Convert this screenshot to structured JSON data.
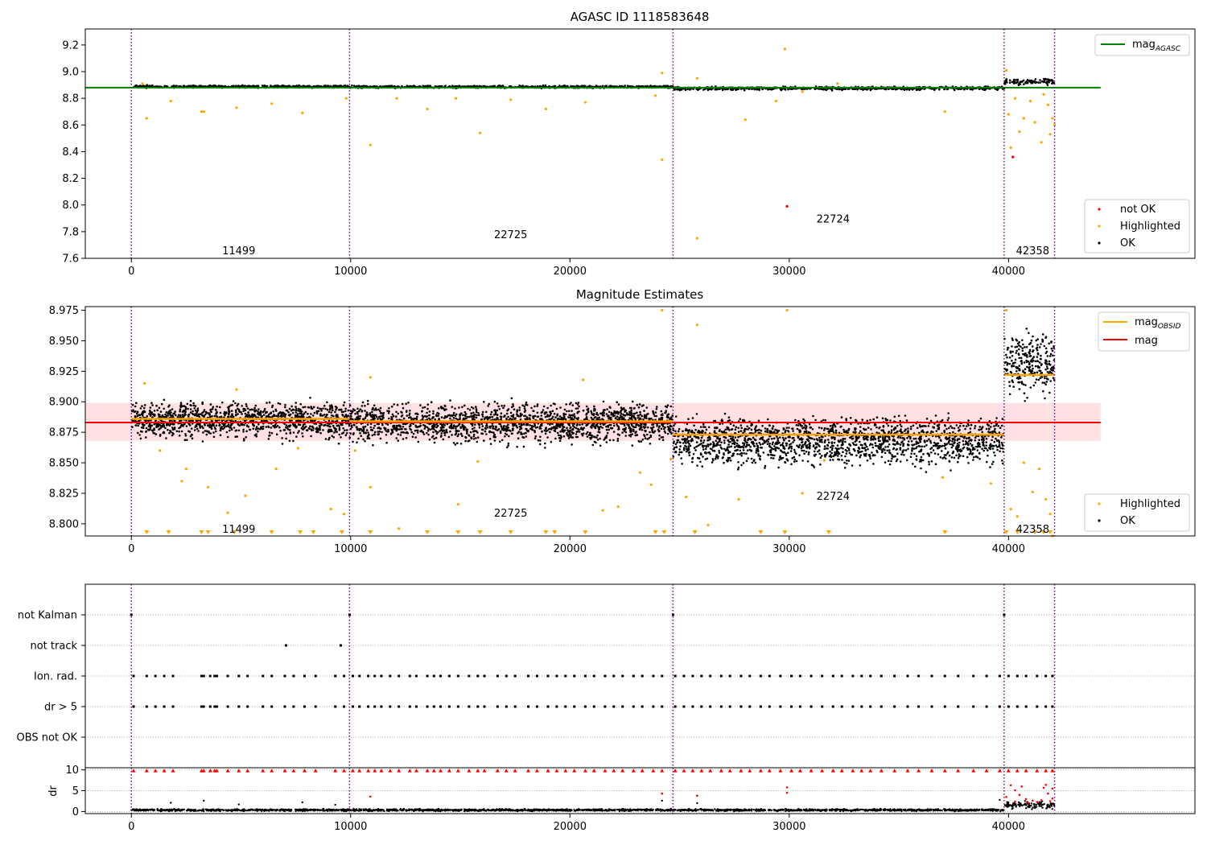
{
  "colors": {
    "ok": "#000000",
    "highlighted": "#ffa500",
    "not_ok": "#ff0000",
    "mag_agasc": "#008000",
    "mag_obsid": "#ffa500",
    "mag": "#ff0000",
    "mag_band": "#ffe0e3",
    "boundary": "#800080",
    "grid": "#b0b0b0"
  },
  "chart_data": [
    {
      "id": "top",
      "type": "scatter",
      "title": "AGASC ID 1118583648",
      "xlim": [
        -2100,
        48500
      ],
      "ylim": [
        7.6,
        9.32
      ],
      "x_ticks": [
        0,
        10000,
        20000,
        30000,
        40000
      ],
      "x_tick_labels": [
        "0",
        "10000",
        "20000",
        "30000",
        "40000"
      ],
      "y_ticks": [
        7.6,
        7.8,
        8.0,
        8.2,
        8.4,
        8.6,
        8.8,
        9.0,
        9.2
      ],
      "y_tick_labels": [
        "7.6",
        "7.8",
        "8.0",
        "8.2",
        "8.4",
        "8.6",
        "8.8",
        "9.0",
        "9.2"
      ],
      "obsid_boundaries": [
        0,
        9950,
        24700,
        39800,
        42100
      ],
      "obsid_labels": [
        {
          "text": "11499",
          "x": 4900,
          "y": 7.66
        },
        {
          "text": "22725",
          "x": 17300,
          "y": 7.78
        },
        {
          "text": "22724",
          "x": 32000,
          "y": 7.9
        },
        {
          "text": "42358",
          "x": 41100,
          "y": 7.66
        }
      ],
      "mag_agasc": {
        "value": 8.88,
        "x_range": [
          -2100,
          44200
        ]
      },
      "ok_bands": [
        {
          "x_range": [
            0,
            9950
          ],
          "center": 8.888,
          "width": 0.012
        },
        {
          "x_range": [
            9950,
            24700
          ],
          "center": 8.886,
          "width": 0.012
        },
        {
          "x_range": [
            24700,
            39800
          ],
          "center": 8.875,
          "width": 0.018
        },
        {
          "x_range": [
            39800,
            42100
          ],
          "center": 8.925,
          "width": 0.03
        }
      ],
      "highlighted_points": [
        [
          500,
          8.91
        ],
        [
          700,
          8.65
        ],
        [
          1800,
          8.78
        ],
        [
          3200,
          8.7
        ],
        [
          3300,
          8.7
        ],
        [
          4800,
          8.73
        ],
        [
          6400,
          8.76
        ],
        [
          7800,
          8.69
        ],
        [
          9800,
          8.8
        ],
        [
          10900,
          8.45
        ],
        [
          12100,
          8.8
        ],
        [
          13500,
          8.72
        ],
        [
          14800,
          8.8
        ],
        [
          15900,
          8.54
        ],
        [
          17300,
          8.79
        ],
        [
          18900,
          8.72
        ],
        [
          20700,
          8.77
        ],
        [
          23900,
          8.82
        ],
        [
          24200,
          8.99
        ],
        [
          24200,
          8.34
        ],
        [
          25800,
          8.95
        ],
        [
          25800,
          7.75
        ],
        [
          28000,
          8.64
        ],
        [
          29400,
          8.78
        ],
        [
          29800,
          9.17
        ],
        [
          30600,
          8.85
        ],
        [
          32200,
          8.91
        ],
        [
          37100,
          8.7
        ],
        [
          40000,
          8.68
        ],
        [
          40100,
          8.43
        ],
        [
          40300,
          8.8
        ],
        [
          40500,
          8.55
        ],
        [
          40700,
          8.65
        ],
        [
          41000,
          8.78
        ],
        [
          41200,
          8.62
        ],
        [
          41500,
          8.47
        ],
        [
          41600,
          8.83
        ],
        [
          41800,
          8.75
        ],
        [
          41900,
          8.53
        ],
        [
          42000,
          8.65
        ],
        [
          42100,
          8.6
        ],
        [
          39900,
          9.01
        ]
      ],
      "not_ok_points": [
        [
          29900,
          7.99
        ],
        [
          40200,
          8.36
        ]
      ],
      "legends": [
        {
          "position": "top-right",
          "entries": [
            {
              "label": "mag",
              "sub": "AGASC",
              "kind": "line",
              "color_key": "mag_agasc"
            }
          ]
        },
        {
          "position": "lower-right",
          "entries": [
            {
              "label": "not OK",
              "kind": "marker",
              "color_key": "not_ok"
            },
            {
              "label": "Highlighted",
              "kind": "marker",
              "color_key": "highlighted"
            },
            {
              "label": "OK",
              "kind": "marker",
              "color_key": "ok"
            }
          ]
        }
      ]
    },
    {
      "id": "mid",
      "type": "scatter",
      "title": "Magnitude Estimates",
      "xlim": [
        -2100,
        48500
      ],
      "ylim": [
        8.79,
        8.978
      ],
      "x_ticks": [
        0,
        10000,
        20000,
        30000,
        40000
      ],
      "x_tick_labels": [
        "0",
        "10000",
        "20000",
        "30000",
        "40000"
      ],
      "y_ticks": [
        8.8,
        8.825,
        8.85,
        8.875,
        8.9,
        8.925,
        8.95,
        8.975
      ],
      "y_tick_labels": [
        "8.800",
        "8.825",
        "8.850",
        "8.875",
        "8.900",
        "8.925",
        "8.950",
        "8.975"
      ],
      "obsid_boundaries": [
        0,
        9950,
        24700,
        39800,
        42100
      ],
      "obsid_labels": [
        {
          "text": "11499",
          "x": 4900,
          "y": 8.796
        },
        {
          "text": "22725",
          "x": 17300,
          "y": 8.809
        },
        {
          "text": "22724",
          "x": 32000,
          "y": 8.823
        },
        {
          "text": "42358",
          "x": 41100,
          "y": 8.796
        }
      ],
      "mag": {
        "value": 8.883,
        "x_range": [
          -2100,
          44200
        ],
        "band": [
          8.868,
          8.899
        ]
      },
      "mag_obsid": [
        {
          "x_range": [
            0,
            9950
          ],
          "value": 8.886
        },
        {
          "x_range": [
            9950,
            24700
          ],
          "value": 8.884
        },
        {
          "x_range": [
            24700,
            39800
          ],
          "value": 8.873
        },
        {
          "x_range": [
            39800,
            42100
          ],
          "value": 8.922
        }
      ],
      "ok_bands": [
        {
          "x_range": [
            0,
            9950
          ],
          "center": 8.885,
          "width": 0.02
        },
        {
          "x_range": [
            9950,
            24700
          ],
          "center": 8.883,
          "width": 0.022
        },
        {
          "x_range": [
            24700,
            39800
          ],
          "center": 8.868,
          "width": 0.026
        },
        {
          "x_range": [
            39800,
            42100
          ],
          "center": 8.93,
          "width": 0.035
        }
      ],
      "highlighted_points": [
        [
          600,
          8.915
        ],
        [
          1300,
          8.86
        ],
        [
          2300,
          8.835
        ],
        [
          2500,
          8.845
        ],
        [
          3500,
          8.83
        ],
        [
          4400,
          8.809
        ],
        [
          4800,
          8.91
        ],
        [
          5200,
          8.823
        ],
        [
          6600,
          8.845
        ],
        [
          7600,
          8.862
        ],
        [
          9100,
          8.812
        ],
        [
          9700,
          8.808
        ],
        [
          10200,
          8.86
        ],
        [
          10900,
          8.83
        ],
        [
          10900,
          8.92
        ],
        [
          12200,
          8.796
        ],
        [
          14900,
          8.816
        ],
        [
          15800,
          8.851
        ],
        [
          20600,
          8.918
        ],
        [
          21500,
          8.811
        ],
        [
          22200,
          8.814
        ],
        [
          23200,
          8.842
        ],
        [
          23700,
          8.832
        ],
        [
          24200,
          8.975
        ],
        [
          24600,
          8.853
        ],
        [
          25300,
          8.822
        ],
        [
          25800,
          8.963
        ],
        [
          26300,
          8.799
        ],
        [
          27700,
          8.82
        ],
        [
          29900,
          8.975
        ],
        [
          30600,
          8.825
        ],
        [
          31600,
          8.852
        ],
        [
          37000,
          8.838
        ],
        [
          39200,
          8.833
        ],
        [
          39900,
          8.975
        ],
        [
          40100,
          8.812
        ],
        [
          40400,
          8.806
        ],
        [
          40700,
          8.85
        ],
        [
          41100,
          8.826
        ],
        [
          41400,
          8.845
        ],
        [
          41700,
          8.82
        ],
        [
          41900,
          8.808
        ],
        [
          42000,
          8.79
        ]
      ],
      "below_range_markers": [
        700,
        1700,
        3200,
        3500,
        4700,
        6400,
        7700,
        8300,
        9600,
        10900,
        13500,
        14900,
        15900,
        17300,
        18900,
        19300,
        20700,
        23900,
        24300,
        25700,
        28700,
        29800,
        31800,
        37100,
        39900,
        40400,
        41200,
        41600,
        41900
      ],
      "legends": [
        {
          "position": "top-right",
          "entries": [
            {
              "label": "mag",
              "sub": "OBSID",
              "kind": "line",
              "color_key": "mag_obsid"
            },
            {
              "label": "mag",
              "kind": "line",
              "color_key": "mag"
            }
          ]
        },
        {
          "position": "lower-right",
          "entries": [
            {
              "label": "Highlighted",
              "kind": "marker",
              "color_key": "highlighted"
            },
            {
              "label": "OK",
              "kind": "marker",
              "color_key": "ok"
            }
          ]
        }
      ]
    },
    {
      "id": "flags",
      "type": "scatter",
      "title": "",
      "xlim": [
        -2100,
        48500
      ],
      "categories": [
        "not Kalman",
        "not track",
        "Ion. rad.",
        "dr > 5",
        "OBS not OK"
      ],
      "obsid_boundaries": [
        0,
        9950,
        24700,
        39800,
        42100
      ],
      "rows": [
        {
          "category": "not Kalman",
          "x": [
            0,
            9950,
            24700,
            39800
          ]
        },
        {
          "category": "not track",
          "x": [
            7050,
            9550
          ]
        },
        {
          "category": "Ion. rad.",
          "x": [
            100,
            700,
            1100,
            1500,
            1900,
            3200,
            3300,
            3600,
            3800,
            3900,
            4400,
            4900,
            5300,
            6000,
            6400,
            7000,
            7400,
            7900,
            8400,
            9300,
            9700,
            10100,
            10400,
            10800,
            11100,
            11400,
            11800,
            12200,
            12700,
            13000,
            13500,
            13800,
            14100,
            14500,
            14900,
            15400,
            15800,
            16100,
            16700,
            17100,
            17500,
            18100,
            18500,
            19000,
            19400,
            19800,
            20200,
            20700,
            21100,
            21600,
            22000,
            22400,
            22900,
            23300,
            23800,
            24200,
            24800,
            25200,
            25600,
            26000,
            26400,
            26900,
            27300,
            27800,
            28200,
            28700,
            29100,
            29600,
            30100,
            30500,
            31000,
            31500,
            32000,
            32400,
            32900,
            33300,
            33700,
            34200,
            34800,
            35400,
            35900,
            36500,
            37100,
            37700,
            38400,
            39000,
            39600,
            40000,
            40400,
            40800,
            41300,
            41700,
            42000
          ]
        },
        {
          "category": "dr > 5",
          "x": [
            100,
            700,
            1100,
            1500,
            1900,
            3200,
            3300,
            3600,
            3800,
            3900,
            4400,
            4900,
            5300,
            6000,
            6400,
            7000,
            7400,
            7900,
            8400,
            9300,
            9700,
            10100,
            10400,
            10800,
            11100,
            11400,
            11800,
            12200,
            12700,
            13000,
            13500,
            13800,
            14100,
            14500,
            14900,
            15400,
            15800,
            16100,
            16700,
            17100,
            17500,
            18100,
            18500,
            19000,
            19400,
            19800,
            20200,
            20700,
            21100,
            21600,
            22000,
            22400,
            22900,
            23300,
            23800,
            24200,
            24800,
            25200,
            25600,
            26000,
            26400,
            26900,
            27300,
            27800,
            28200,
            28700,
            29100,
            29600,
            30100,
            30500,
            31000,
            31500,
            32000,
            32400,
            32900,
            33300,
            33700,
            34200,
            34800,
            35400,
            35900,
            36500,
            37100,
            37700,
            38400,
            39000,
            39600,
            40000,
            40400,
            40800,
            41300,
            41700,
            42000
          ]
        },
        {
          "category": "OBS not OK",
          "x": []
        }
      ]
    },
    {
      "id": "dr",
      "type": "scatter",
      "title": "",
      "ylabel": "dr",
      "xlim": [
        -2100,
        48500
      ],
      "ylim": [
        -0.5,
        10.5
      ],
      "x_ticks": [
        0,
        10000,
        20000,
        30000,
        40000
      ],
      "x_tick_labels": [
        "0",
        "10000",
        "20000",
        "30000",
        "40000"
      ],
      "y_ticks": [
        0,
        5,
        10
      ],
      "y_tick_labels": [
        "0",
        "5",
        "10"
      ],
      "obsid_boundaries": [
        0,
        9950,
        24700,
        39800,
        42100
      ],
      "ok_bands": [
        {
          "x_range": [
            0,
            39800
          ],
          "center": 0.35,
          "width": 0.35
        },
        {
          "x_range": [
            39800,
            42100
          ],
          "center": 1.6,
          "width": 1.2
        }
      ],
      "ok_points": [
        [
          1800,
          2.1
        ],
        [
          3300,
          2.6
        ],
        [
          4900,
          1.7
        ],
        [
          7800,
          2.2
        ],
        [
          9300,
          1.6
        ],
        [
          24200,
          2.6
        ],
        [
          25800,
          2.0
        ],
        [
          39600,
          2.8
        ]
      ],
      "clipped_red_x": [
        100,
        700,
        1100,
        1500,
        1900,
        3200,
        3300,
        3600,
        3800,
        3900,
        4400,
        4900,
        5300,
        6000,
        6400,
        7000,
        7400,
        7900,
        8400,
        9300,
        9700,
        10100,
        10400,
        10800,
        11100,
        11400,
        11800,
        12200,
        12700,
        13000,
        13500,
        13800,
        14100,
        14500,
        14900,
        15400,
        15800,
        16100,
        16700,
        17100,
        17500,
        18100,
        18500,
        19000,
        19400,
        19800,
        20200,
        20700,
        21100,
        21600,
        22000,
        22400,
        22900,
        23300,
        23800,
        24200,
        24800,
        25200,
        25600,
        26000,
        26400,
        26900,
        27300,
        27800,
        28200,
        28700,
        29100,
        29600,
        30100,
        30500,
        31000,
        31500,
        32000,
        32400,
        32900,
        33300,
        33700,
        34200,
        34800,
        35400,
        35900,
        36500,
        37100,
        37700,
        38400,
        39000,
        39600,
        40000,
        40400,
        40800,
        41300,
        41700,
        42000
      ],
      "red_points": [
        [
          10900,
          3.6
        ],
        [
          24200,
          4.3
        ],
        [
          25800,
          3.8
        ],
        [
          29900,
          5.8
        ],
        [
          29900,
          4.5
        ],
        [
          39900,
          3.5
        ],
        [
          40100,
          6.3
        ],
        [
          40300,
          5.1
        ],
        [
          40500,
          4.0
        ],
        [
          40800,
          3.0
        ],
        [
          41100,
          2.6
        ],
        [
          41500,
          2.7
        ],
        [
          41700,
          6.4
        ],
        [
          41800,
          4.3
        ],
        [
          42000,
          5.5
        ],
        [
          40300,
          2.4
        ],
        [
          40900,
          2.1
        ],
        [
          41300,
          2.3
        ],
        [
          41900,
          2.5
        ],
        [
          42000,
          3.1
        ],
        [
          40600,
          6.0
        ],
        [
          41600,
          5.7
        ]
      ]
    }
  ]
}
